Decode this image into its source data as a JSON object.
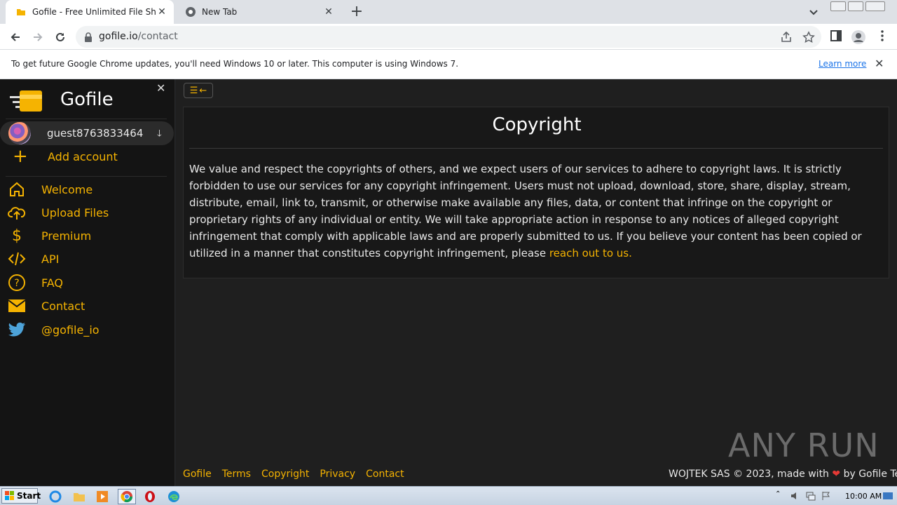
{
  "browser": {
    "tabs": [
      {
        "title": "Gofile - Free Unlimited File Sharing an",
        "favicon": "folder-icon"
      },
      {
        "title": "New Tab",
        "favicon": "chrome-icon"
      }
    ],
    "url_host": "gofile.io",
    "url_path": "/contact",
    "update_message": "To get future Google Chrome updates, you'll need Windows 10 or later. This computer is using Windows 7.",
    "learn_more": "Learn more"
  },
  "sidebar": {
    "brand": "Gofile",
    "account": "guest8763833464",
    "add_account": "Add account",
    "items": [
      {
        "label": "Welcome",
        "icon": "home-icon"
      },
      {
        "label": "Upload Files",
        "icon": "cloud-upload-icon"
      },
      {
        "label": "Premium",
        "icon": "dollar-icon"
      },
      {
        "label": "API",
        "icon": "code-icon"
      },
      {
        "label": "FAQ",
        "icon": "question-icon"
      },
      {
        "label": "Contact",
        "icon": "envelope-icon"
      },
      {
        "label": "@gofile_io",
        "icon": "twitter-icon"
      }
    ]
  },
  "main": {
    "title": "Copyright",
    "body": "We value and respect the copyrights of others, and we expect users of our services to adhere to copyright laws. It is strictly forbidden to use our services for any copyright infringement. Users must not upload, download, store, share, display, stream, distribute, email, link to, transmit, or otherwise make available any files, data, or content that infringe on the copyright or proprietary rights of any individual or entity. We will take appropriate action in response to any notices of alleged copyright infringement that comply with applicable laws and are properly submitted to us. If you believe your content has been copied or utilized in a manner that constitutes copyright infringement, please ",
    "link": "reach out to us."
  },
  "footer": {
    "links": [
      "Gofile",
      "Terms",
      "Copyright",
      "Privacy",
      "Contact"
    ],
    "left_text": "WOJTEK SAS © 2023, made with",
    "heart": "❤",
    "right_text": "by Gofile Team"
  },
  "watermark": "ANY RUN",
  "taskbar": {
    "start": "Start",
    "clock": "10:00 AM"
  },
  "colors": {
    "accent": "#f5b301",
    "sidebar": "#141414",
    "main": "#1f1f1f"
  }
}
